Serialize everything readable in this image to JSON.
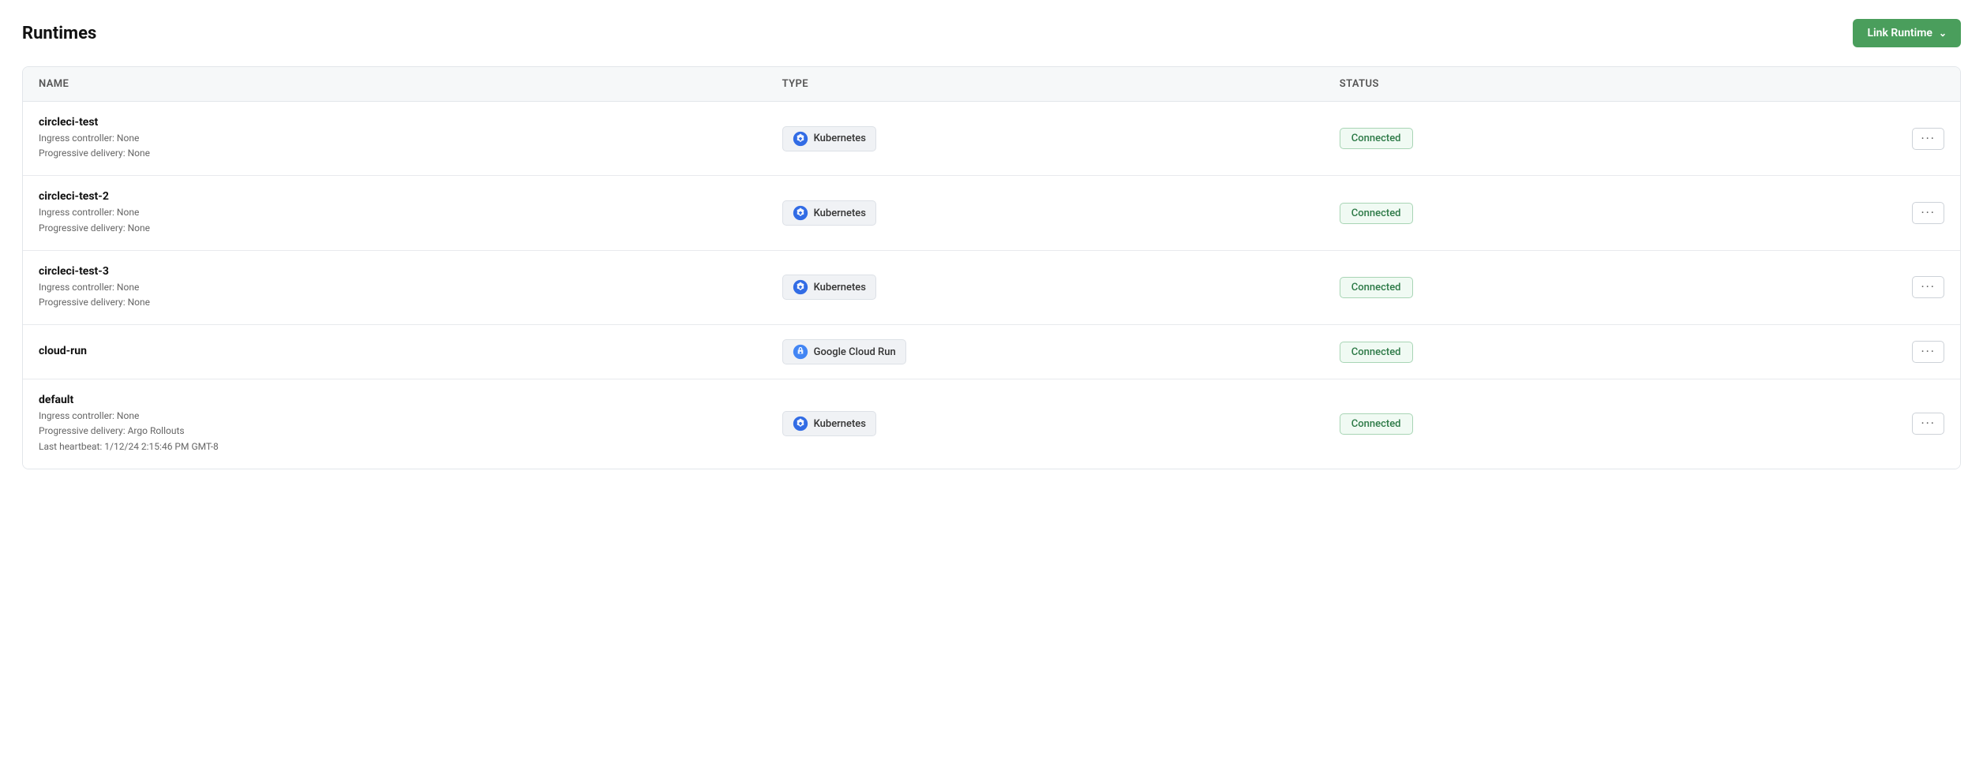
{
  "page": {
    "title": "Runtimes",
    "link_runtime_btn": "Link Runtime"
  },
  "table": {
    "columns": [
      {
        "key": "name",
        "label": "Name"
      },
      {
        "key": "type",
        "label": "Type"
      },
      {
        "key": "status",
        "label": "Status"
      }
    ],
    "rows": [
      {
        "id": "circleci-test",
        "name": "circleci-test",
        "meta": [
          "Ingress controller: None",
          "Progressive delivery: None"
        ],
        "type": "Kubernetes",
        "type_icon": "kubernetes",
        "status": "Connected"
      },
      {
        "id": "circleci-test-2",
        "name": "circleci-test-2",
        "meta": [
          "Ingress controller: None",
          "Progressive delivery: None"
        ],
        "type": "Kubernetes",
        "type_icon": "kubernetes",
        "status": "Connected"
      },
      {
        "id": "circleci-test-3",
        "name": "circleci-test-3",
        "meta": [
          "Ingress controller: None",
          "Progressive delivery: None"
        ],
        "type": "Kubernetes",
        "type_icon": "kubernetes",
        "status": "Connected"
      },
      {
        "id": "cloud-run",
        "name": "cloud-run",
        "meta": [],
        "type": "Google Cloud Run",
        "type_icon": "google-cloud-run",
        "status": "Connected"
      },
      {
        "id": "default",
        "name": "default",
        "meta": [
          "Ingress controller: None",
          "Progressive delivery: Argo Rollouts",
          "Last heartbeat: 1/12/24 2:15:46 PM GMT-8"
        ],
        "type": "Kubernetes",
        "type_icon": "kubernetes",
        "status": "Connected"
      }
    ]
  },
  "icons": {
    "chevron_down": "∨",
    "more_options": "···"
  }
}
